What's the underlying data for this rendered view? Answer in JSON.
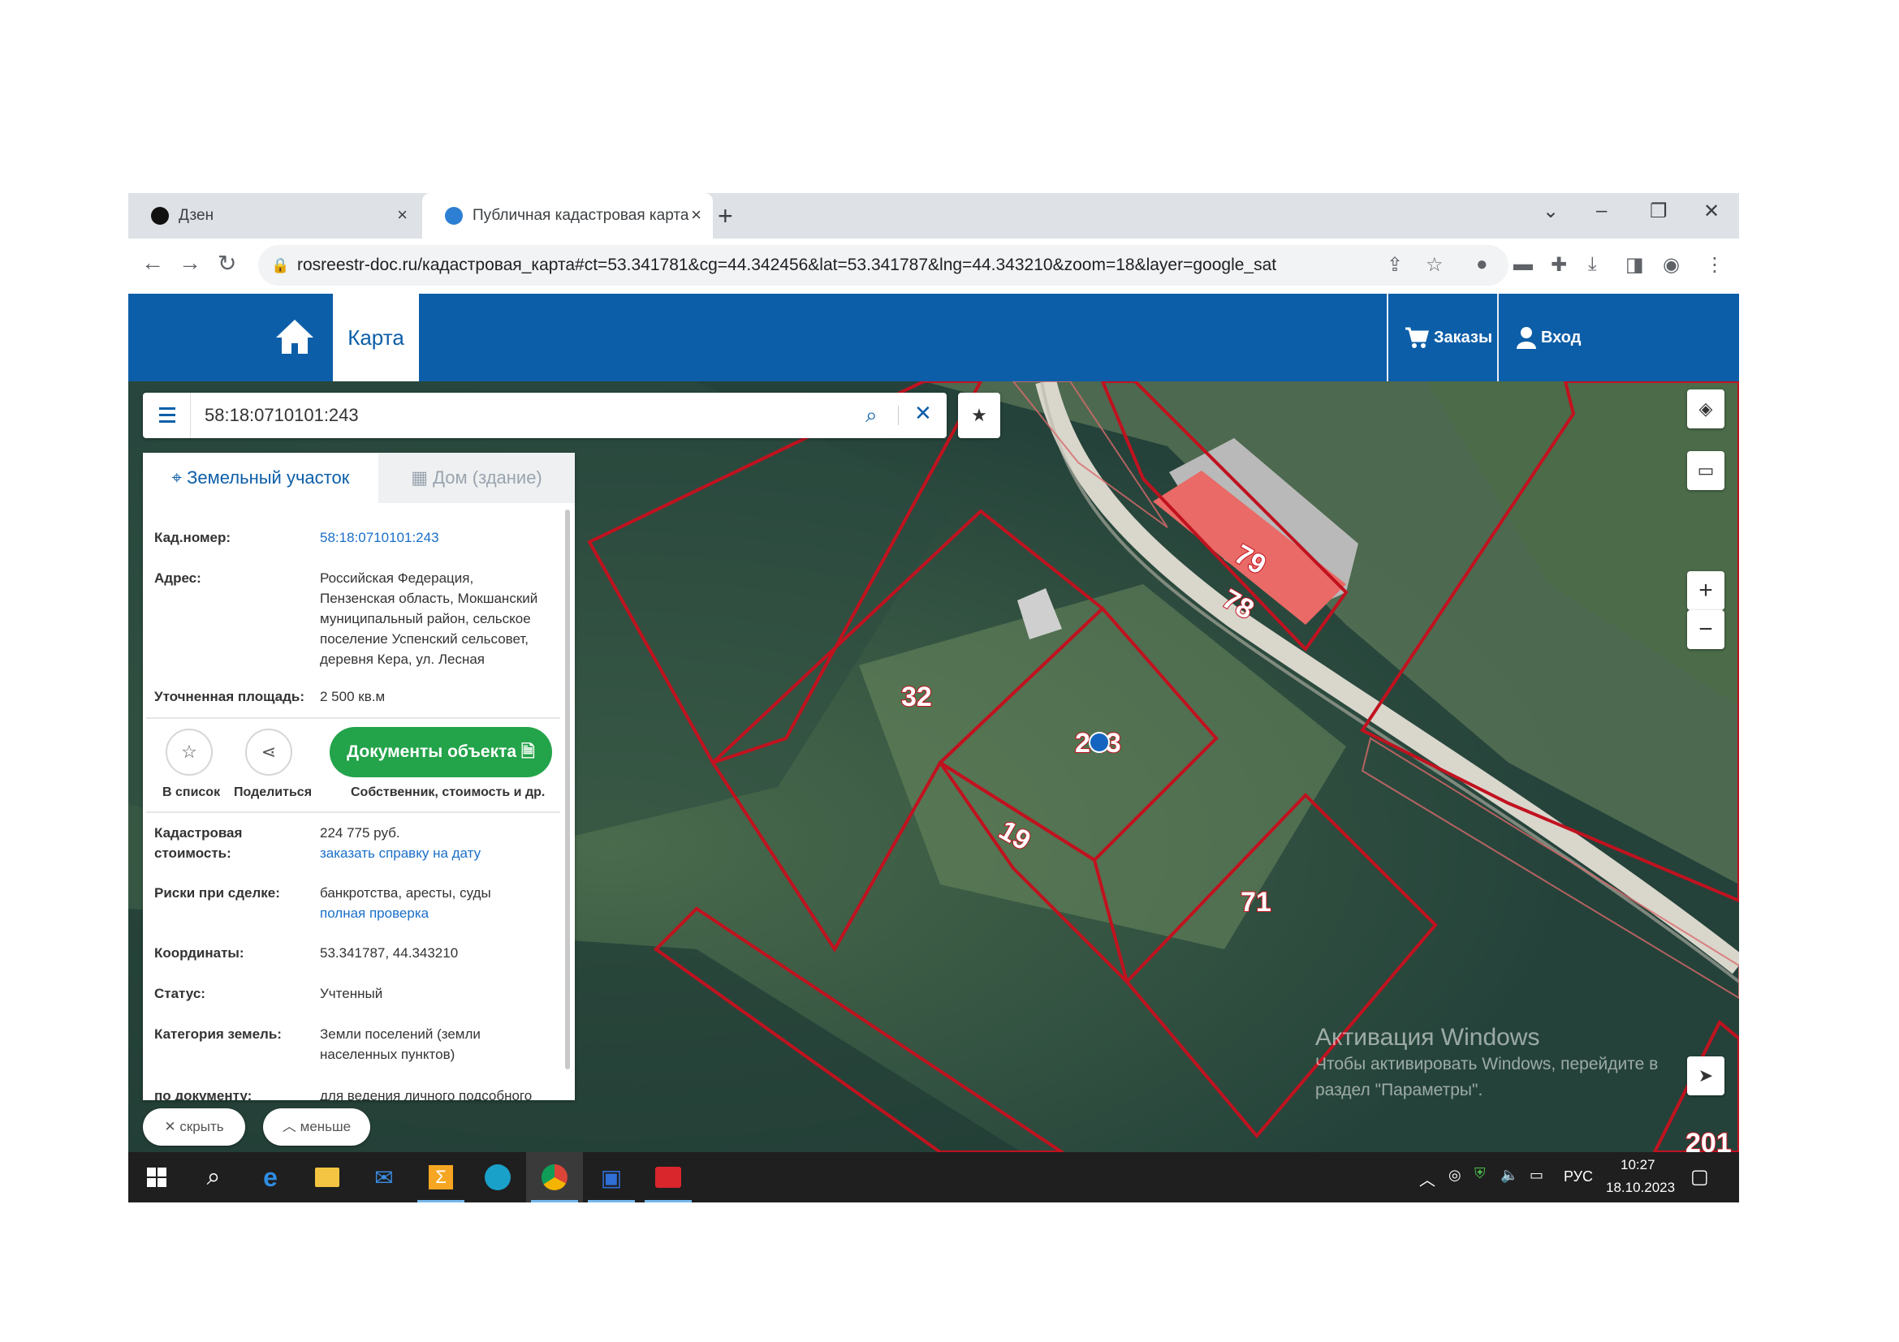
{
  "browser": {
    "tabs": [
      {
        "label": "Дзен",
        "active": false
      },
      {
        "label": "Публичная кадастровая карта",
        "active": true
      }
    ],
    "new_tab_label": "+",
    "url": "rosreestr-doc.ru/кадастровая_карта#ct=53.341781&cg=44.342456&lat=53.341787&lng=44.343210&zoom=18&layer=google_sat"
  },
  "site": {
    "nav_map_label": "Карта",
    "orders_label": "Заказы",
    "login_label": "Вход",
    "brand_color": "#0d5ea8"
  },
  "search": {
    "value": "58:18:0710101:243"
  },
  "panel": {
    "tabs": [
      "Земельный участок",
      "Дом (здание)"
    ],
    "fields": {
      "cad_number_label": "Кад.номер:",
      "cad_number_value": "58:18:0710101:243",
      "address_label": "Адрес:",
      "address_lines": [
        "Российская Федерация,",
        "Пензенская область, Мокшанский",
        "муниципальный район, сельское",
        "поселение Успенский сельсовет,",
        "деревня Кера, ул. Лесная"
      ],
      "area_label": "Уточненная площадь:",
      "area_value": "2 500 кв.м",
      "cost_label_lines": [
        "Кадастровая",
        "стоимость:"
      ],
      "cost_value": "224 775 руб.",
      "cost_link": "заказать справку на дату",
      "risks_label": "Риски при сделке:",
      "risks_value": "банкротства, аресты, суды",
      "risks_link": "полная проверка",
      "coords_label": "Координаты:",
      "coords_value": "53.341787, 44.343210",
      "status_label": "Статус:",
      "status_value": "Учтенный",
      "category_label": "Категория земель:",
      "category_lines": [
        "Земли поселений (земли",
        "населенных пунктов)"
      ],
      "cutoff_label": "по документу:",
      "cutoff_value": "для ведения личного подсобного"
    },
    "actions": {
      "to_list": "В список",
      "share": "Поделиться",
      "docs_button": "Документы объекта",
      "docs_sub": "Собственник, стоимость и др."
    },
    "hide_label": "скрыть",
    "less_label": "меньше"
  },
  "map": {
    "parcel_labels": [
      "79",
      "78",
      "32",
      "243",
      "19",
      "71",
      "201"
    ],
    "zoom_in": "+",
    "zoom_out": "−",
    "parcel_color": "#c1121f",
    "building_color": "#e96a66"
  },
  "watermark": {
    "title": "Активация Windows",
    "line1": "Чтобы активировать Windows, перейдите в",
    "line2": "раздел \"Параметры\"."
  },
  "taskbar": {
    "lang": "РУС",
    "time": "10:27",
    "date": "18.10.2023"
  }
}
